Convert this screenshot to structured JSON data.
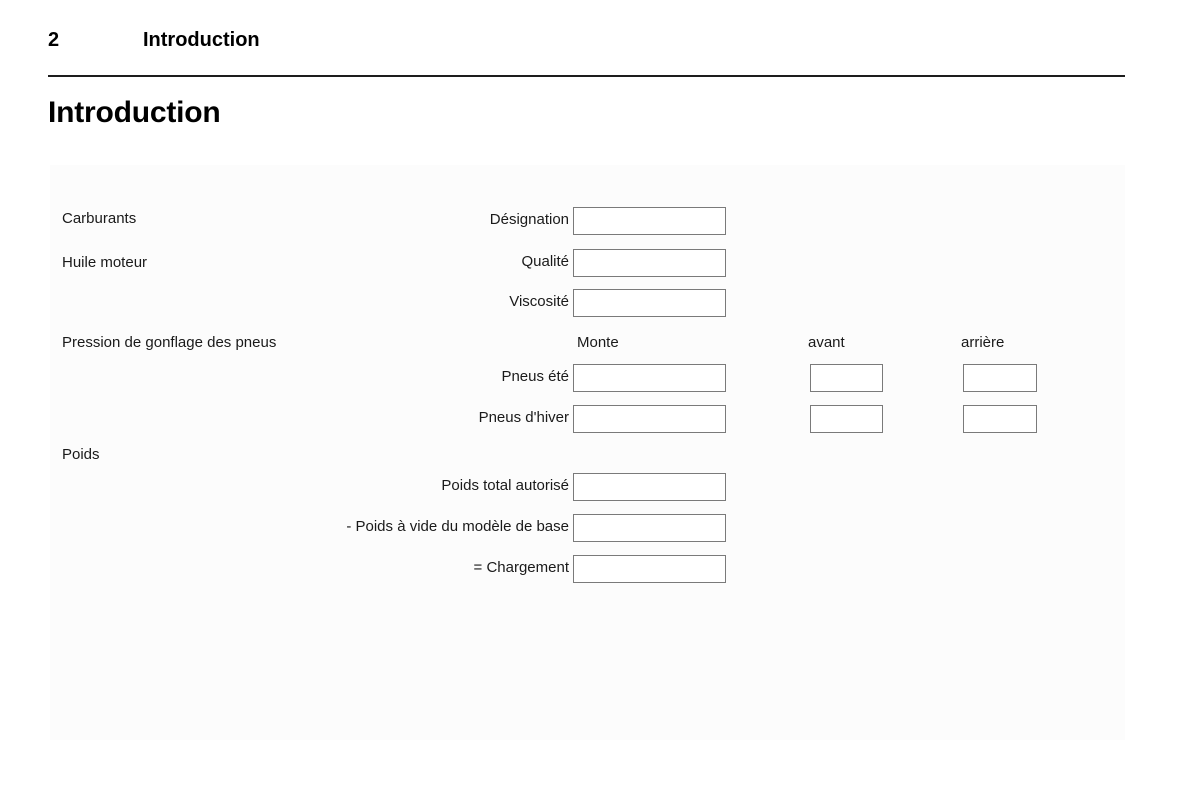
{
  "header": {
    "page_number": "2",
    "title": "Introduction"
  },
  "chapter": {
    "title": "Introduction"
  },
  "form": {
    "sections": [
      {
        "label": "Carburants"
      },
      {
        "label": "Huile moteur"
      },
      {
        "label": "Pression de gonflage des pneus"
      },
      {
        "label": "Poids"
      }
    ],
    "column_headers": [
      {
        "label": "Monte"
      },
      {
        "label": "avant"
      },
      {
        "label": "arrière"
      }
    ],
    "rows": [
      {
        "label": "Désignation"
      },
      {
        "label": "Qualité"
      },
      {
        "label": "Viscosité"
      },
      {
        "label": "Pneus été"
      },
      {
        "label": "Pneus d'hiver"
      },
      {
        "label": "Poids total autorisé"
      },
      {
        "label": "- Poids à vide du modèle de base"
      },
      {
        "label": "= Chargement"
      }
    ],
    "field_values": {
      "designation": "",
      "qualite": "",
      "viscosite": "",
      "pneus_ete_monte": "",
      "pneus_ete_avant": "",
      "pneus_ete_arriere": "",
      "pneus_hiver_monte": "",
      "pneus_hiver_avant": "",
      "pneus_hiver_arriere": "",
      "poids_total_autorise": "",
      "poids_a_vide": "",
      "chargement": ""
    }
  },
  "colors": {
    "rule": "#1d1d1d",
    "panel_background": "#fcfcfc",
    "field_border": "#7a7a7a",
    "text": "#1a1a1a"
  }
}
